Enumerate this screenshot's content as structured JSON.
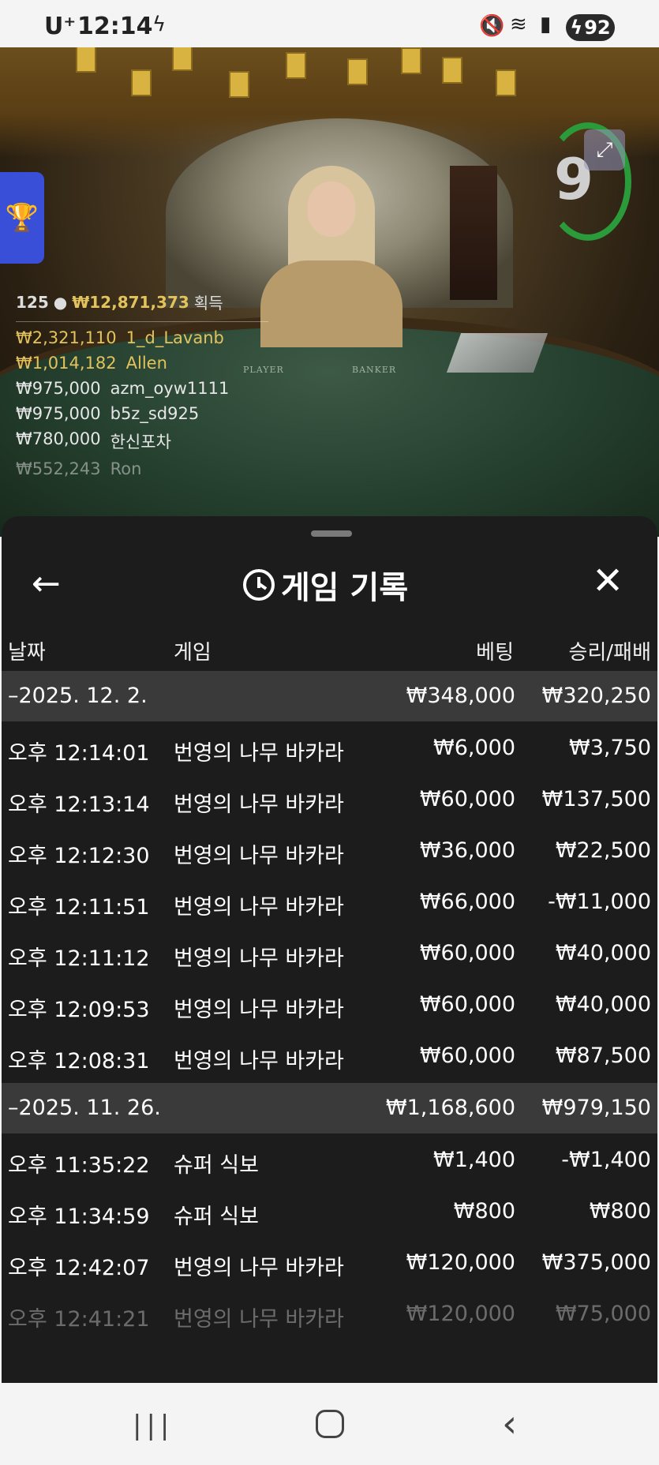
{
  "status_bar": {
    "carrier": "U⁺",
    "time": "12:14",
    "battery": "92",
    "icons": [
      "charging-bolt-icon",
      "mute-icon",
      "wifi-icon",
      "signal-icon",
      "battery-icon"
    ]
  },
  "video": {
    "timer_count": "9",
    "table_labels": {
      "player": "PLAYER",
      "banker": "BANKER"
    },
    "leaderboard": {
      "players_count": "125",
      "total_amount": "₩12,871,373",
      "gain_label": "획득",
      "entries": [
        {
          "amount": "₩2,321,110",
          "name": "1_d_Lavanb"
        },
        {
          "amount": "₩1,014,182",
          "name": "Allen"
        },
        {
          "amount": "₩975,000",
          "name": "azm_oyw1111"
        },
        {
          "amount": "₩975,000",
          "name": "b5z_sd925"
        },
        {
          "amount": "₩780,000",
          "name": "한신포차"
        },
        {
          "amount": "₩552,243",
          "name": "Ron"
        }
      ]
    }
  },
  "history": {
    "title": "게임 기록",
    "columns": {
      "date": "날짜",
      "game": "게임",
      "bet": "베팅",
      "result": "승리/패배"
    },
    "groups": [
      {
        "date": "–2025. 12. 2.",
        "bet_total": "₩348,000",
        "result_total": "₩320,250",
        "rows": [
          {
            "time": "오후 12:14:01",
            "game": "번영의 나무 바카라",
            "bet": "₩6,000",
            "result": "₩3,750"
          },
          {
            "time": "오후 12:13:14",
            "game": "번영의 나무 바카라",
            "bet": "₩60,000",
            "result": "₩137,500"
          },
          {
            "time": "오후 12:12:30",
            "game": "번영의 나무 바카라",
            "bet": "₩36,000",
            "result": "₩22,500"
          },
          {
            "time": "오후 12:11:51",
            "game": "번영의 나무 바카라",
            "bet": "₩66,000",
            "result": "-₩11,000"
          },
          {
            "time": "오후 12:11:12",
            "game": "번영의 나무 바카라",
            "bet": "₩60,000",
            "result": "₩40,000"
          },
          {
            "time": "오후 12:09:53",
            "game": "번영의 나무 바카라",
            "bet": "₩60,000",
            "result": "₩40,000"
          },
          {
            "time": "오후 12:08:31",
            "game": "번영의 나무 바카라",
            "bet": "₩60,000",
            "result": "₩87,500"
          }
        ]
      },
      {
        "date": "–2025. 11. 26.",
        "bet_total": "₩1,168,600",
        "result_total": "₩979,150",
        "rows": [
          {
            "time": "오후 11:35:22",
            "game": "슈퍼 식보",
            "bet": "₩1,400",
            "result": "-₩1,400"
          },
          {
            "time": "오후 11:34:59",
            "game": "슈퍼 식보",
            "bet": "₩800",
            "result": "₩800"
          },
          {
            "time": "오후 12:42:07",
            "game": "번영의 나무 바카라",
            "bet": "₩120,000",
            "result": "₩375,000"
          },
          {
            "time": "오후 12:41:21",
            "game": "번영의 나무 바카라",
            "bet": "₩120,000",
            "result": "₩75,000"
          }
        ]
      }
    ]
  },
  "colors": {
    "panel_bg": "#1c1c1c",
    "date_row_bg": "#3a3a3a",
    "gold": "#e2c35b",
    "timer_ring": "#2a9a3a"
  }
}
